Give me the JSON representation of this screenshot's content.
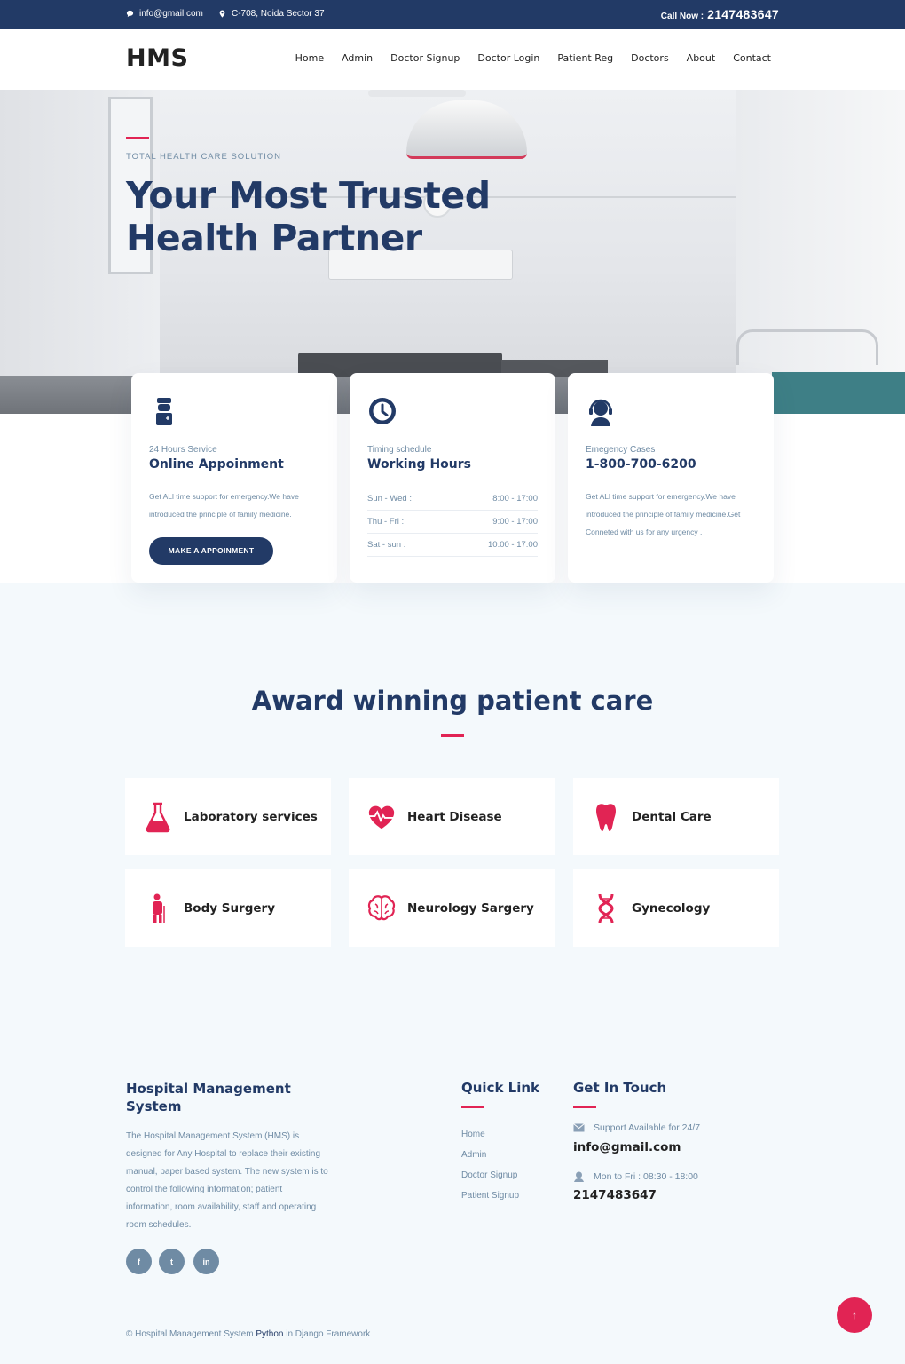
{
  "topbar": {
    "email": "info@gmail.com",
    "address": "C-708, Noida Sector 37",
    "call_label": "Call Now :",
    "call_number": "2147483647"
  },
  "navbar": {
    "logo": "HMS",
    "links": [
      "Home",
      "Admin",
      "Doctor Signup",
      "Doctor Login",
      "Patient Reg",
      "Doctors",
      "About",
      "Contact"
    ]
  },
  "hero": {
    "eyebrow": "TOTAL HEALTH CARE SOLUTION",
    "title_line1": "Your Most Trusted",
    "title_line2": "Health Partner"
  },
  "cards": {
    "appointment": {
      "sub": "24 Hours Service",
      "title": "Online Appoinment",
      "text": "Get ALl time support for emergency.We have introduced the principle of family medicine.",
      "button": "MAKE A APPOINMENT",
      "icon": "doctor-icon"
    },
    "hours": {
      "sub": "Timing schedule",
      "title": "Working Hours",
      "icon": "clock-icon",
      "rows": [
        {
          "day": "Sun - Wed :",
          "time": "8:00 - 17:00"
        },
        {
          "day": "Thu - Fri :",
          "time": "9:00 - 17:00"
        },
        {
          "day": "Sat - sun :",
          "time": "10:00 - 17:00"
        }
      ]
    },
    "emergency": {
      "sub": "Emegency Cases",
      "title": "1-800-700-6200",
      "text": "Get ALl time support for emergency.We have introduced the principle of family medicine.Get Conneted with us for any urgency .",
      "icon": "headset-icon"
    }
  },
  "services": {
    "title": "Award winning patient care",
    "items": [
      {
        "label": "Laboratory services",
        "icon": "flask-icon"
      },
      {
        "label": "Heart Disease",
        "icon": "heartbeat-icon"
      },
      {
        "label": "Dental Care",
        "icon": "tooth-icon"
      },
      {
        "label": "Body Surgery",
        "icon": "patient-icon"
      },
      {
        "label": "Neurology Sargery",
        "icon": "brain-icon"
      },
      {
        "label": "Gynecology",
        "icon": "dna-icon"
      }
    ]
  },
  "footer": {
    "about_title": "Hospital Management System",
    "about_text": "The Hospital Management System (HMS) is designed for Any Hospital to replace their existing manual, paper based system. The new system is to control the following information; patient information, room availability, staff and operating room schedules.",
    "social": [
      "f",
      "t",
      "in"
    ],
    "quick_title": "Quick Link",
    "quick_links": [
      "Home",
      "Admin",
      "Doctor Signup",
      "Patient Signup"
    ],
    "touch_title": "Get In Touch",
    "support_text": "Support Available for 24/7",
    "support_email": "info@gmail.com",
    "hours_text": "Mon to Fri : 08:30 - 18:00",
    "phone": "2147483647",
    "copyright_pre": "© Hospital Management System",
    "copyright_py": "Python",
    "copyright_post": "in Django Framework",
    "scroll_top": "↑"
  },
  "colors": {
    "navy": "#223a66",
    "accent": "#e12454",
    "muted": "#6f8ba4",
    "light_bg": "#f4f9fc"
  }
}
